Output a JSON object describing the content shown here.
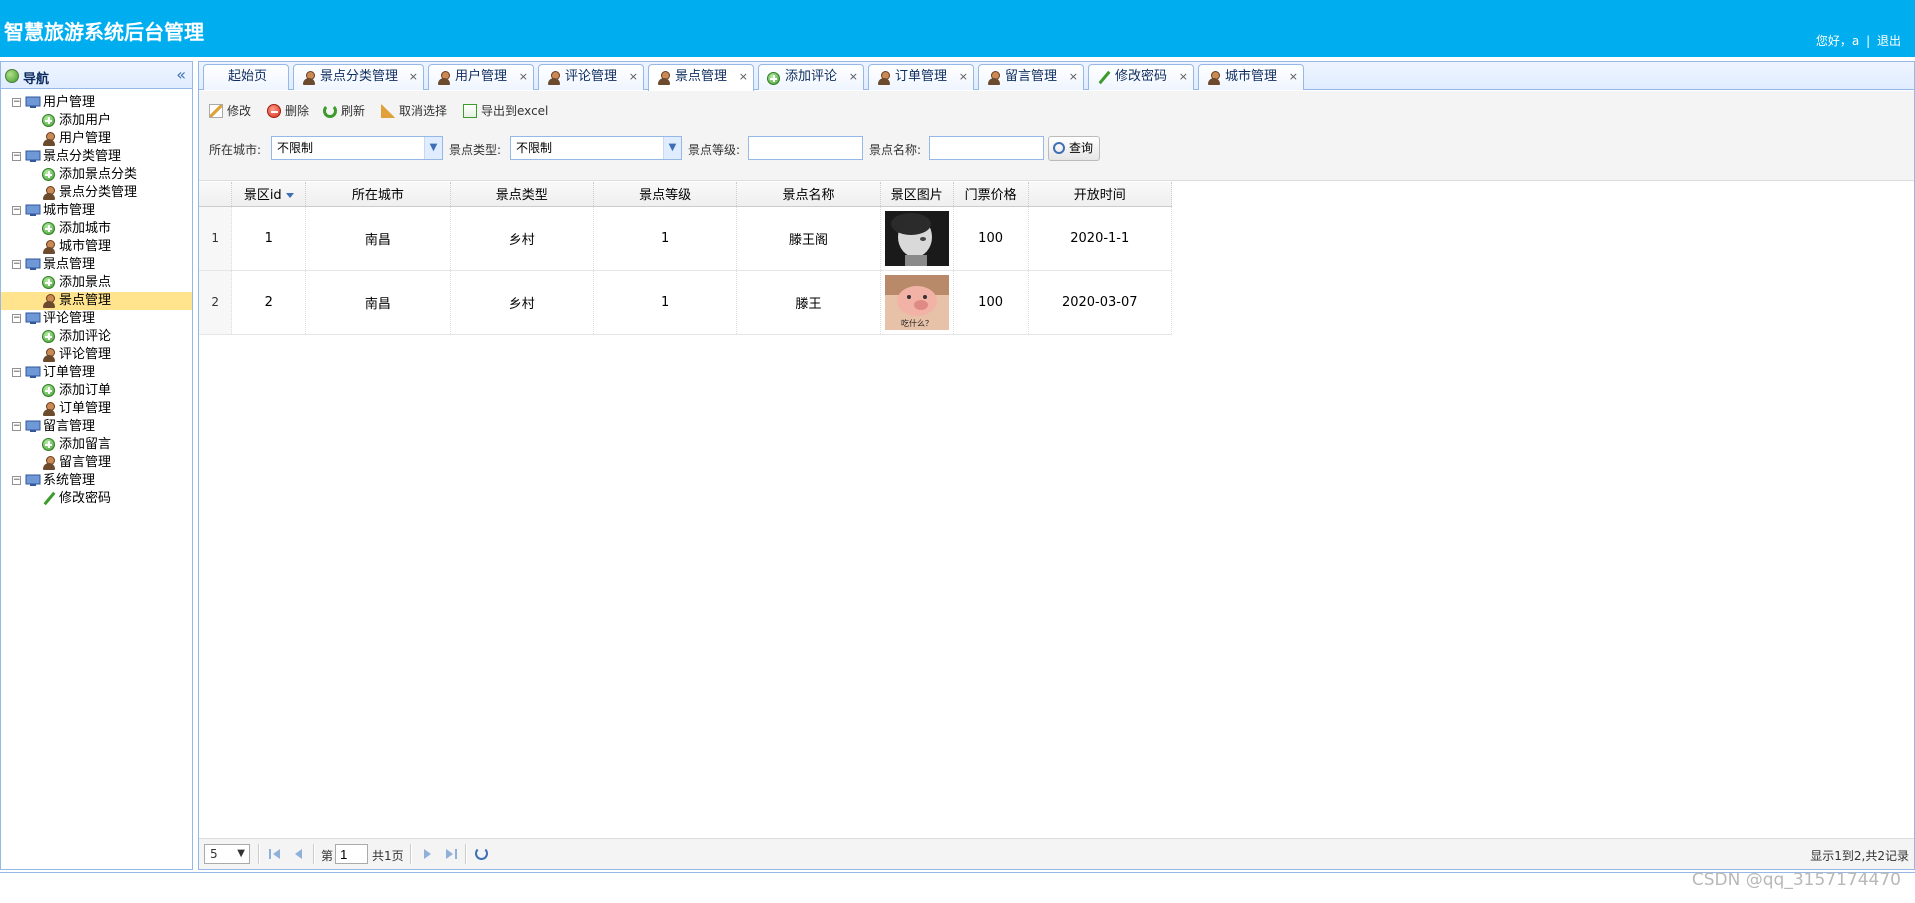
{
  "header": {
    "title": "智慧旅游系统后台管理",
    "greeting": "您好，a",
    "separator": "|",
    "logout": "退出"
  },
  "nav": {
    "title": "导航",
    "collapse_icon": "«",
    "groups": [
      {
        "label": "用户管理",
        "items": [
          {
            "label": "添加用户",
            "icon": "add-icon"
          },
          {
            "label": "用户管理",
            "icon": "user-icon"
          }
        ]
      },
      {
        "label": "景点分类管理",
        "items": [
          {
            "label": "添加景点分类",
            "icon": "add-icon"
          },
          {
            "label": "景点分类管理",
            "icon": "user-icon"
          }
        ]
      },
      {
        "label": "城市管理",
        "items": [
          {
            "label": "添加城市",
            "icon": "add-icon"
          },
          {
            "label": "城市管理",
            "icon": "user-icon"
          }
        ]
      },
      {
        "label": "景点管理",
        "items": [
          {
            "label": "添加景点",
            "icon": "add-icon"
          },
          {
            "label": "景点管理",
            "icon": "user-icon",
            "selected": true
          }
        ]
      },
      {
        "label": "评论管理",
        "items": [
          {
            "label": "添加评论",
            "icon": "add-icon"
          },
          {
            "label": "评论管理",
            "icon": "user-icon"
          }
        ]
      },
      {
        "label": "订单管理",
        "items": [
          {
            "label": "添加订单",
            "icon": "add-icon"
          },
          {
            "label": "订单管理",
            "icon": "user-icon"
          }
        ]
      },
      {
        "label": "留言管理",
        "items": [
          {
            "label": "添加留言",
            "icon": "add-icon"
          },
          {
            "label": "留言管理",
            "icon": "user-icon"
          }
        ]
      },
      {
        "label": "系统管理",
        "items": [
          {
            "label": "修改密码",
            "icon": "pencil-icon"
          }
        ]
      }
    ]
  },
  "tabs": [
    {
      "label": "起始页",
      "icon": "none",
      "closable": false
    },
    {
      "label": "景点分类管理",
      "icon": "user-icon",
      "closable": true
    },
    {
      "label": "用户管理",
      "icon": "user-icon",
      "closable": true
    },
    {
      "label": "评论管理",
      "icon": "user-icon",
      "closable": true
    },
    {
      "label": "景点管理",
      "icon": "user-icon",
      "closable": true,
      "active": true
    },
    {
      "label": "添加评论",
      "icon": "add-icon",
      "closable": true
    },
    {
      "label": "订单管理",
      "icon": "user-icon",
      "closable": true
    },
    {
      "label": "留言管理",
      "icon": "user-icon",
      "closable": true
    },
    {
      "label": "修改密码",
      "icon": "pencil-icon",
      "closable": true
    },
    {
      "label": "城市管理",
      "icon": "user-icon",
      "closable": true
    }
  ],
  "tab_close_glyph": "×",
  "toolbar": {
    "edit": "修改",
    "delete": "删除",
    "refresh": "刷新",
    "unselect": "取消选择",
    "export": "导出到excel"
  },
  "filters": {
    "city_label": "所在城市:",
    "city_value": "不限制",
    "type_label": "景点类型:",
    "type_value": "不限制",
    "level_label": "景点等级:",
    "level_value": "",
    "name_label": "景点名称:",
    "name_value": "",
    "search_button": "查询"
  },
  "grid": {
    "columns": [
      "景区id",
      "所在城市",
      "景点类型",
      "景点等级",
      "景点名称",
      "景区图片",
      "门票价格",
      "开放时间"
    ],
    "rows": [
      {
        "rownum": "1",
        "id": "1",
        "city": "南昌",
        "type": "乡村",
        "level": "1",
        "name": "滕王阁",
        "image": "child-photo",
        "price": "100",
        "open": "2020-1-1"
      },
      {
        "rownum": "2",
        "id": "2",
        "city": "南昌",
        "type": "乡村",
        "level": "1",
        "name": "滕王",
        "image": "piglet-photo",
        "image_caption": "吃什么？",
        "price": "100",
        "open": "2020-03-07"
      }
    ]
  },
  "pager": {
    "page_size": "5",
    "page_prefix": "第",
    "page_number": "1",
    "page_total": "共1页",
    "info": "显示1到2,共2记录"
  },
  "watermark": "CSDN @qq_3157174470",
  "colors": {
    "header_bg": "#00aeef",
    "border": "#95b8e7",
    "selected_row": "#ffe48d"
  }
}
